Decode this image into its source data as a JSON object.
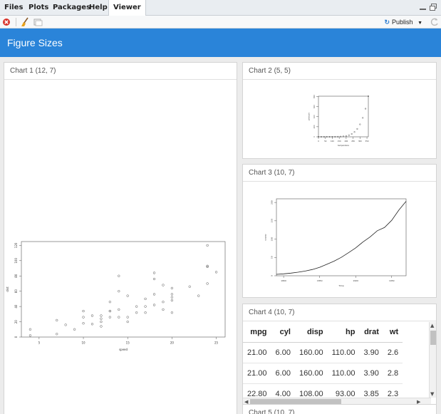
{
  "tabs": [
    {
      "label": "Files"
    },
    {
      "label": "Plots"
    },
    {
      "label": "Packages"
    },
    {
      "label": "Help"
    },
    {
      "label": "Viewer"
    }
  ],
  "toolbar": {
    "publish_label": "Publish",
    "publish_glyph": "↻"
  },
  "header": {
    "title": "Figure Sizes"
  },
  "cards": {
    "chart1": {
      "title": "Chart 1 (12, 7)"
    },
    "chart2": {
      "title": "Chart 2 (5, 5)"
    },
    "chart3": {
      "title": "Chart 3 (10, 7)"
    },
    "chart4": {
      "title": "Chart 4 (10, 7)"
    },
    "chart5": {
      "title": "Chart 5 (10, 7)"
    }
  },
  "chart_data": [
    {
      "type": "scatter",
      "title": "",
      "xlabel": "speed",
      "ylabel": "dist",
      "xlim": [
        3,
        26
      ],
      "ylim": [
        0,
        125
      ],
      "xticks": [
        5,
        10,
        15,
        20,
        25
      ],
      "yticks": [
        0,
        20,
        40,
        60,
        80,
        100,
        120
      ],
      "x": [
        4,
        4,
        7,
        7,
        8,
        9,
        10,
        10,
        10,
        11,
        11,
        12,
        12,
        12,
        12,
        13,
        13,
        13,
        13,
        14,
        14,
        14,
        14,
        15,
        15,
        15,
        16,
        16,
        17,
        17,
        17,
        18,
        18,
        18,
        18,
        19,
        19,
        19,
        20,
        20,
        20,
        20,
        20,
        22,
        23,
        24,
        24,
        24,
        24,
        25
      ],
      "y": [
        2,
        10,
        4,
        22,
        16,
        10,
        18,
        26,
        34,
        17,
        28,
        14,
        20,
        24,
        28,
        26,
        34,
        34,
        46,
        26,
        36,
        60,
        80,
        20,
        26,
        54,
        32,
        40,
        32,
        40,
        50,
        42,
        56,
        76,
        84,
        36,
        46,
        68,
        32,
        48,
        52,
        56,
        64,
        66,
        54,
        70,
        92,
        93,
        120,
        85
      ]
    },
    {
      "type": "scatter",
      "title": "",
      "xlabel": "temperature",
      "ylabel": "pressure",
      "xlim": [
        0,
        360
      ],
      "ylim": [
        0,
        806
      ],
      "xticks": [
        0,
        50,
        100,
        150,
        200,
        250,
        300,
        350
      ],
      "yticks": [
        0,
        200,
        400,
        600,
        800
      ],
      "x": [
        0,
        20,
        40,
        60,
        80,
        100,
        120,
        140,
        160,
        180,
        200,
        220,
        240,
        260,
        280,
        300,
        320,
        340,
        360
      ],
      "y": [
        0.0002,
        0.0012,
        0.006,
        0.03,
        0.09,
        0.27,
        0.75,
        1.85,
        4.2,
        8.8,
        17.3,
        32.1,
        57,
        96,
        157,
        247,
        376,
        558,
        806
      ]
    },
    {
      "type": "line",
      "title": "",
      "xlabel": "Time",
      "ylabel": "uspop",
      "xlim": [
        1790,
        1970
      ],
      "ylim": [
        0,
        210
      ],
      "xticks": [
        1800,
        1850,
        1900,
        1950
      ],
      "yticks": [
        0,
        50,
        100,
        150,
        200
      ],
      "x": [
        1790,
        1800,
        1810,
        1820,
        1830,
        1840,
        1850,
        1860,
        1870,
        1880,
        1890,
        1900,
        1910,
        1920,
        1930,
        1940,
        1950,
        1960,
        1970
      ],
      "y": [
        3.93,
        5.31,
        7.24,
        9.64,
        12.9,
        17.1,
        23.2,
        31.4,
        39.8,
        50.2,
        62.9,
        76,
        92,
        105.7,
        122.8,
        131.7,
        151.3,
        179.3,
        203.2
      ]
    },
    {
      "type": "table",
      "columns": [
        "mpg",
        "cyl",
        "disp",
        "hp",
        "drat",
        "wt"
      ],
      "rows": [
        [
          "21.00",
          "6.00",
          "160.00",
          "110.00",
          "3.90",
          "2.6"
        ],
        [
          "21.00",
          "6.00",
          "160.00",
          "110.00",
          "3.90",
          "2.8"
        ],
        [
          "22.80",
          "4.00",
          "108.00",
          "93.00",
          "3.85",
          "2.3"
        ]
      ]
    }
  ]
}
